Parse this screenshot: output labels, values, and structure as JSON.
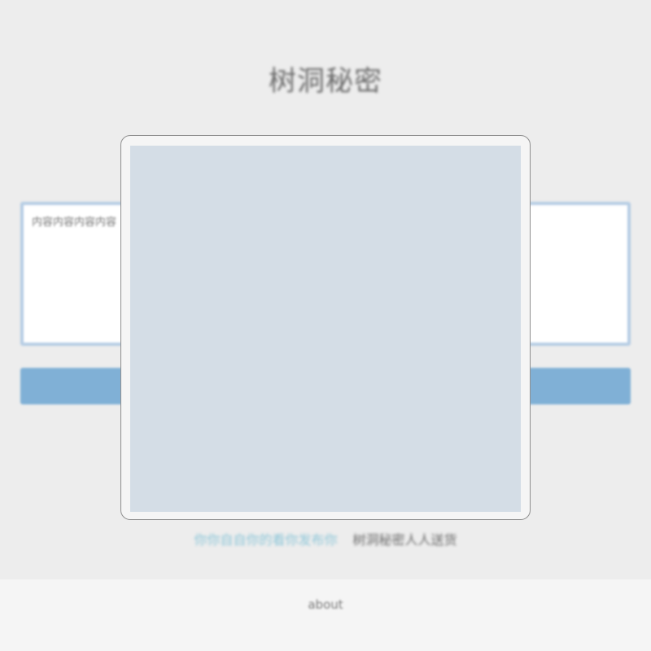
{
  "page": {
    "title": "树洞秘密"
  },
  "form": {
    "textarea_placeholder": "内容内容内容内容",
    "submit_label": ""
  },
  "links": {
    "link1": "你你自自你的看你发布你",
    "link2": "树洞秘密人人送货"
  },
  "footer": {
    "about": "about"
  },
  "colors": {
    "background": "#ededed",
    "accent": "#80b0d6",
    "modal_body": "#d4dde6"
  }
}
